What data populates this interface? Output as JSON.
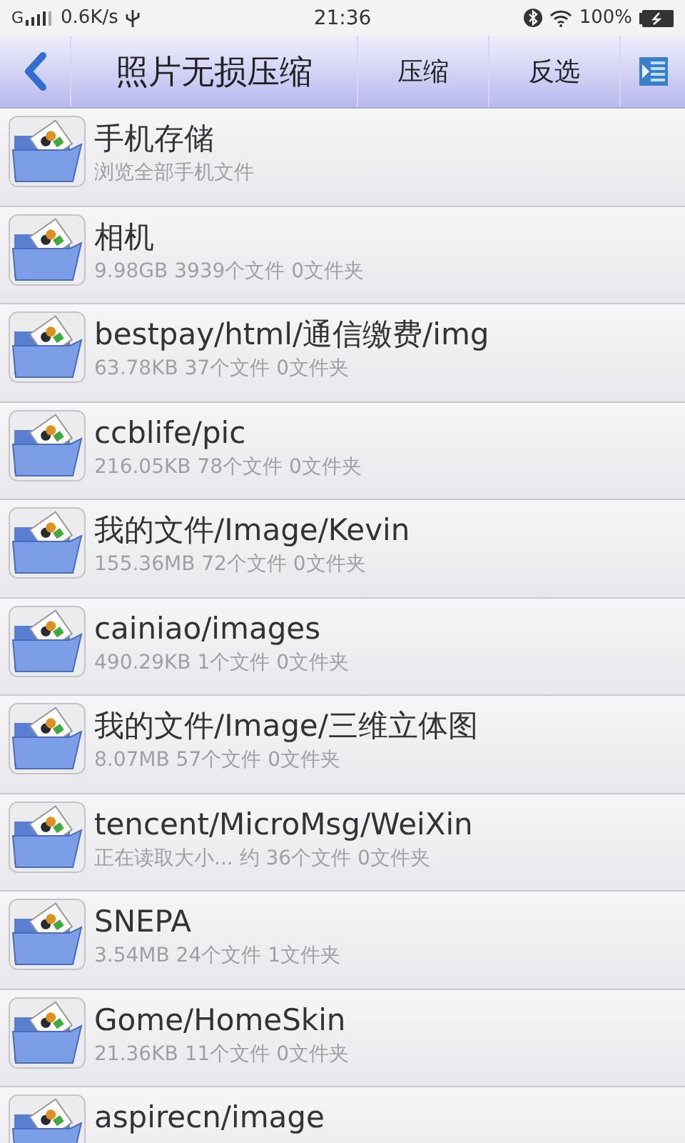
{
  "status_bar": {
    "network_type": "G",
    "network_speed": "0.6K/s",
    "time": "21:36",
    "battery": "100%"
  },
  "header": {
    "title": "照片无损压缩",
    "actions": [
      "压缩",
      "反选"
    ]
  },
  "folders": [
    {
      "name": "手机存储",
      "info": "浏览全部手机文件"
    },
    {
      "name": "相机",
      "info": "9.98GB 3939个文件 0文件夹"
    },
    {
      "name": "bestpay/html/通信缴费/img",
      "info": "63.78KB 37个文件 0文件夹"
    },
    {
      "name": "ccblife/pic",
      "info": "216.05KB 78个文件 0文件夹"
    },
    {
      "name": "我的文件/Image/Kevin",
      "info": "155.36MB 72个文件 0文件夹"
    },
    {
      "name": "cainiao/images",
      "info": "490.29KB 1个文件 0文件夹"
    },
    {
      "name": "我的文件/Image/三维立体图",
      "info": "8.07MB 57个文件 0文件夹"
    },
    {
      "name": "tencent/MicroMsg/WeiXin",
      "info": "正在读取大小... 约 36个文件 0文件夹"
    },
    {
      "name": "SNEPA",
      "info": "3.54MB 24个文件 1文件夹"
    },
    {
      "name": "Gome/HomeSkin",
      "info": "21.36KB 11个文件 0文件夹"
    },
    {
      "name": "aspirecn/image"
    }
  ]
}
